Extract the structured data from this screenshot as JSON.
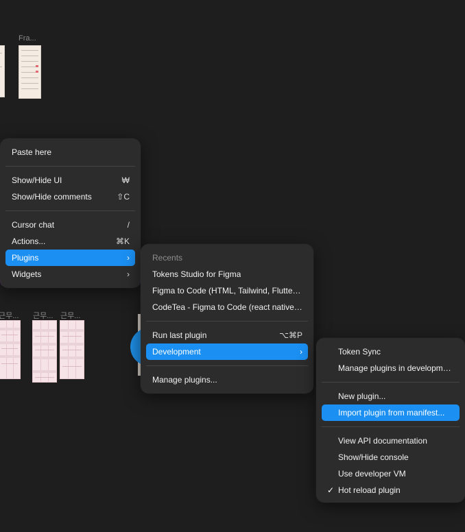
{
  "canvas": {
    "frame_labels": {
      "top": "Fra...",
      "bottom_left": "근무...",
      "bottom_mid1": "근무...",
      "bottom_mid2": "근무..."
    }
  },
  "main_menu": {
    "items": [
      {
        "label": "Paste here",
        "shortcut": ""
      },
      {
        "label": "Show/Hide UI",
        "shortcut": "₩"
      },
      {
        "label": "Show/Hide comments",
        "shortcut": "⇧C"
      },
      {
        "label": "Cursor chat",
        "shortcut": "/"
      },
      {
        "label": "Actions...",
        "shortcut": "⌘K"
      },
      {
        "label": "Plugins",
        "shortcut": "›"
      },
      {
        "label": "Widgets",
        "shortcut": "›"
      }
    ]
  },
  "plugins_menu": {
    "header": "Recents",
    "items": [
      {
        "label": "Tokens Studio for Figma",
        "shortcut": ""
      },
      {
        "label": "Figma to Code (HTML, Tailwind, Flutter, ...",
        "shortcut": ""
      },
      {
        "label": "CodeTea - Figma to Code (react native, ...",
        "shortcut": ""
      },
      {
        "label": "Run last plugin",
        "shortcut": "⌥⌘P"
      },
      {
        "label": "Development",
        "shortcut": "›"
      },
      {
        "label": "Manage plugins...",
        "shortcut": ""
      }
    ]
  },
  "development_menu": {
    "items": [
      {
        "label": "Token Sync"
      },
      {
        "label": "Manage plugins in development"
      },
      {
        "label": "New plugin..."
      },
      {
        "label": "Import plugin from manifest..."
      },
      {
        "label": "View API documentation"
      },
      {
        "label": "Show/Hide console"
      },
      {
        "label": "Use developer VM"
      },
      {
        "label": "Hot reload plugin",
        "check": "✓"
      }
    ]
  },
  "colors": {
    "canvas_bg": "#1e1e1e",
    "menu_bg": "#2c2c2c",
    "highlight": "#1b8ff2"
  }
}
